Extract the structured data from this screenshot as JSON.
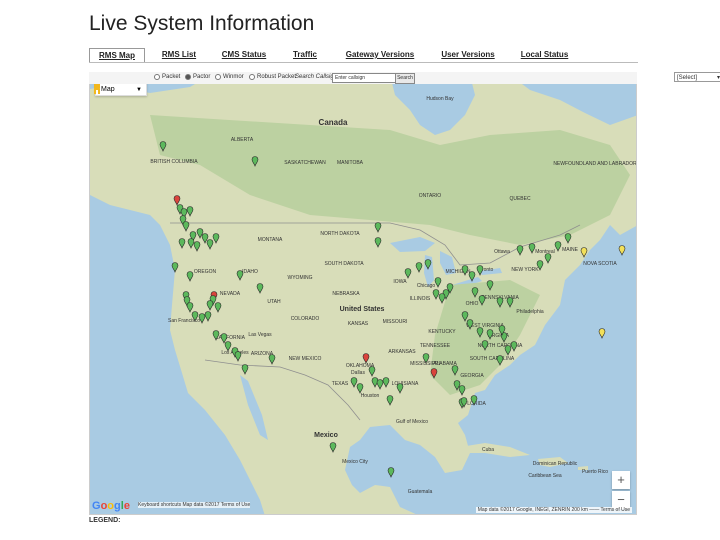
{
  "page_title": "Live System Information",
  "tabs": [
    {
      "label": "RMS Map",
      "active": true
    },
    {
      "label": "RMS List"
    },
    {
      "label": "CMS Status"
    },
    {
      "label": "Traffic"
    },
    {
      "label": "Gateway Versions"
    },
    {
      "label": "User Versions"
    },
    {
      "label": "Local Status"
    }
  ],
  "controls": {
    "radios": [
      {
        "label": "Packet",
        "selected": false
      },
      {
        "label": "Pactor",
        "selected": true
      },
      {
        "label": "Winmor",
        "selected": false
      },
      {
        "label": "Robust Packet",
        "selected": false
      }
    ],
    "search_label": "Search Callsign",
    "search_value": "Enter callsign",
    "search_button": "Search",
    "select_value": "[Select]"
  },
  "map": {
    "type_control": "Map",
    "zoom_in": "+",
    "zoom_out": "−",
    "google_logo": "Google",
    "attribution_left": "Keyboard shortcuts  Map data ©2017  Terms of Use",
    "attribution_right": "Map data ©2017 Google, INEGI, ZENRIN   200 km ——  Terms of Use",
    "water_color": "#a9cbe3",
    "land_color": "#d8ddb9",
    "forest_color": "#bcd1a1",
    "marker_colors": {
      "online": "#5cb85c",
      "offline": "#d9443c",
      "busy": "#f2e05a"
    },
    "labels": [
      {
        "text": "Canada",
        "bold": true
      },
      {
        "text": "United States",
        "bold": true
      },
      {
        "text": "Mexico",
        "bold": true
      },
      {
        "text": "Hudson Bay"
      },
      {
        "text": "BRITISH COLUMBIA"
      },
      {
        "text": "ALBERTA"
      },
      {
        "text": "SASKATCHEWAN"
      },
      {
        "text": "MANITOBA"
      },
      {
        "text": "ONTARIO"
      },
      {
        "text": "QUEBEC"
      },
      {
        "text": "NEWFOUNDLAND AND LABRADOR"
      },
      {
        "text": "MONTANA"
      },
      {
        "text": "NORTH DAKOTA"
      },
      {
        "text": "SOUTH DAKOTA"
      },
      {
        "text": "OREGON"
      },
      {
        "text": "IDAHO"
      },
      {
        "text": "WYOMING"
      },
      {
        "text": "NEVADA"
      },
      {
        "text": "UTAH"
      },
      {
        "text": "COLORADO"
      },
      {
        "text": "NEBRASKA"
      },
      {
        "text": "KANSAS"
      },
      {
        "text": "CALIFORNIA"
      },
      {
        "text": "ARIZONA"
      },
      {
        "text": "NEW MEXICO"
      },
      {
        "text": "OKLAHOMA"
      },
      {
        "text": "TEXAS"
      },
      {
        "text": "IOWA"
      },
      {
        "text": "MISSOURI"
      },
      {
        "text": "ILLINOIS"
      },
      {
        "text": "MICHIGAN"
      },
      {
        "text": "OHIO"
      },
      {
        "text": "KENTUCKY"
      },
      {
        "text": "TENNESSEE"
      },
      {
        "text": "ARKANSAS"
      },
      {
        "text": "MISSISSIPPI"
      },
      {
        "text": "ALABAMA"
      },
      {
        "text": "GEORGIA"
      },
      {
        "text": "LOUISIANA"
      },
      {
        "text": "FLORIDA"
      },
      {
        "text": "WEST VIRGINIA"
      },
      {
        "text": "VIRGINIA"
      },
      {
        "text": "NORTH CAROLINA"
      },
      {
        "text": "SOUTH CAROLINA"
      },
      {
        "text": "PENNSYLVANIA"
      },
      {
        "text": "NEW YORK"
      },
      {
        "text": "MAINE"
      },
      {
        "text": "NOVA SCOTIA"
      },
      {
        "text": "Toronto"
      },
      {
        "text": "Ottawa"
      },
      {
        "text": "Montreal"
      },
      {
        "text": "Chicago"
      },
      {
        "text": "Philadelphia"
      },
      {
        "text": "Las Vegas"
      },
      {
        "text": "Los Angeles"
      },
      {
        "text": "San Francisco"
      },
      {
        "text": "Dallas"
      },
      {
        "text": "Houston"
      },
      {
        "text": "Mexico City"
      },
      {
        "text": "Cuba"
      },
      {
        "text": "Dominican Republic"
      },
      {
        "text": "Puerto Rico"
      },
      {
        "text": "Guatemala"
      },
      {
        "text": "Gulf of Mexico"
      },
      {
        "text": "Caribbean Sea"
      }
    ]
  },
  "legend_label": "LEGEND:"
}
